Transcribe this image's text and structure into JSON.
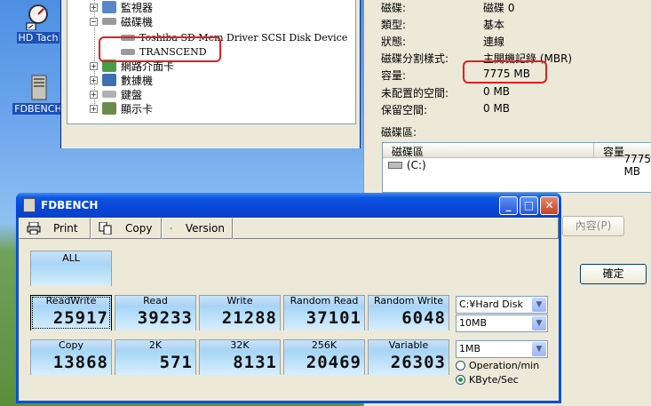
{
  "desktop": {
    "icons": [
      {
        "label": "HD Tach",
        "icon": "hdtach-icon"
      },
      {
        "label": "FDBENCH",
        "icon": "fdbench-icon"
      }
    ]
  },
  "device_tree": {
    "items": [
      {
        "label": "監視器",
        "expanded": false
      },
      {
        "label": "磁碟機",
        "expanded": true
      },
      {
        "label": "Toshiba SD Mem Driver SCSI Disk Device",
        "child": true
      },
      {
        "label": "TRANSCEND",
        "child": true
      },
      {
        "label": "網路介面卡",
        "expanded": false
      },
      {
        "label": "數據機",
        "expanded": false
      },
      {
        "label": "鍵盤",
        "expanded": false
      },
      {
        "label": "顯示卡",
        "expanded": false
      }
    ]
  },
  "disk_props": {
    "rows": [
      {
        "key": "磁碟:",
        "value": "磁碟 0"
      },
      {
        "key": "類型:",
        "value": "基本"
      },
      {
        "key": "狀態:",
        "value": "連線"
      },
      {
        "key": "磁碟分割樣式:",
        "value": "主開機記錄 (MBR)"
      },
      {
        "key": "容量:",
        "value": "7775 MB"
      },
      {
        "key": "未配置的空間:",
        "value": "0 MB"
      },
      {
        "key": "保留空間:",
        "value": "0 MB"
      }
    ],
    "volumes_label": "磁碟區:",
    "volume_columns": [
      "磁碟區",
      "容量"
    ],
    "volumes": [
      {
        "name": "(C:)",
        "size": "7775 MB"
      }
    ],
    "props_button": "內容(P)",
    "ok_button": "確定"
  },
  "fdbench": {
    "title": "FDBENCH",
    "toolbar": {
      "print": "Print",
      "copy": "Copy",
      "version": "Version"
    },
    "all_label": "ALL",
    "row1": [
      {
        "caption": "ReadWrite",
        "value": "25917",
        "selected": true
      },
      {
        "caption": "Read",
        "value": "39233"
      },
      {
        "caption": "Write",
        "value": "21288"
      },
      {
        "caption": "Random Read",
        "value": "37101"
      },
      {
        "caption": "Random Write",
        "value": "6048"
      }
    ],
    "row2": [
      {
        "caption": "Copy",
        "value": "13868"
      },
      {
        "caption": "2K",
        "value": "571"
      },
      {
        "caption": "32K",
        "value": "8131"
      },
      {
        "caption": "256K",
        "value": "20469"
      },
      {
        "caption": "Variable",
        "value": "26303"
      }
    ],
    "drive_select": "C:¥Hard Disk",
    "size_select": "10MB",
    "block_select": "1MB",
    "unit_options": [
      {
        "label": "Operation/min",
        "checked": false
      },
      {
        "label": "KByte/Sec",
        "checked": true
      }
    ]
  }
}
